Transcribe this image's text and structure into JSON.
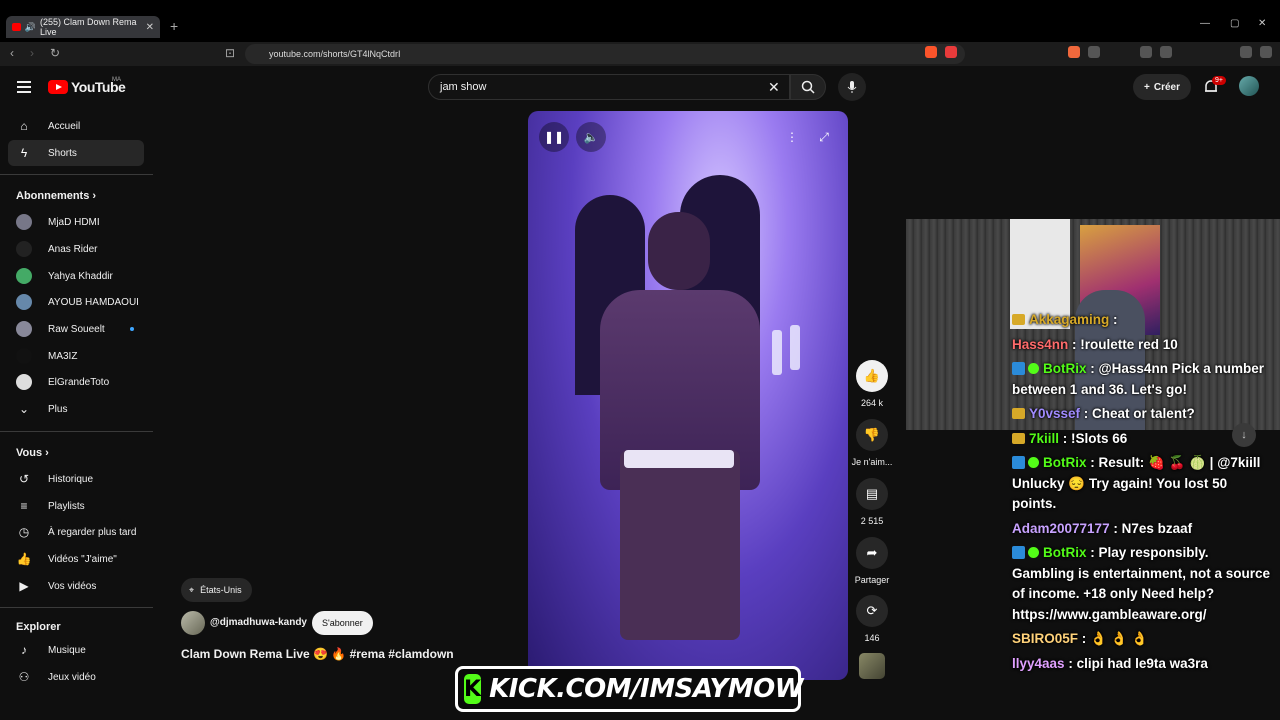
{
  "browser": {
    "tab_title": "(255) Clam Down Rema Live",
    "url": "youtube.com/shorts/GT4lNqCtdrI",
    "new_tab": "+",
    "close_tab": "✕"
  },
  "header": {
    "logo_text": "YouTube",
    "region": "MA",
    "search_value": "jam show",
    "create_label": "Créer",
    "notif_count": "9+"
  },
  "sidebar": {
    "main": [
      {
        "label": "Accueil",
        "icon": "home-icon"
      },
      {
        "label": "Shorts",
        "icon": "shorts-icon"
      }
    ],
    "subs_title": "Abonnements",
    "subs": [
      {
        "label": "MjaD HDMI"
      },
      {
        "label": "Anas Rider"
      },
      {
        "label": "Yahya Khaddir"
      },
      {
        "label": "AYOUB HAMDAOUI"
      },
      {
        "label": "Raw Soueelt"
      },
      {
        "label": "MA3IZ"
      },
      {
        "label": "ElGrandeToto"
      },
      {
        "label": "Plus"
      }
    ],
    "you_title": "Vous",
    "you": [
      {
        "label": "Historique"
      },
      {
        "label": "Playlists"
      },
      {
        "label": "À regarder plus tard"
      },
      {
        "label": "Vidéos \"J'aime\""
      },
      {
        "label": "Vos vidéos"
      }
    ],
    "explore_title": "Explorer",
    "explore": [
      {
        "label": "Musique"
      },
      {
        "label": "Jeux vidéo"
      }
    ]
  },
  "short": {
    "location": "États-Unis",
    "channel": "@djmadhuwa-kandy",
    "subscribe": "S'abonner",
    "title": "Clam Down Rema Live 😍 🔥 #rema #clamdown",
    "likes": "264 k",
    "dislike_label": "Je n'aim...",
    "comments": "2 515",
    "share_label": "Partager",
    "remix": "146"
  },
  "chat": [
    {
      "user": "Akkagaming",
      "msg": "",
      "color": "#d7a928",
      "badge": "mod"
    },
    {
      "user": "Hass4nn",
      "msg": "!roulette red 10",
      "color": "#ff6b6b",
      "badge": ""
    },
    {
      "user": "BotRix",
      "msg": "@Hass4nn Pick a number between 1 and 36. Let's go!",
      "color": "#53fc18",
      "badge": "bot"
    },
    {
      "user": "Y0vssef",
      "msg": "Cheat or talent?",
      "color": "#a08bff",
      "badge": "mod"
    },
    {
      "user": "7kiill",
      "msg": "!Slots 66",
      "color": "#53fc18",
      "badge": "mod"
    },
    {
      "user": "BotRix",
      "msg": "Result: 🍓 🍒 🍈 | @7kiill Unlucky 😔 Try again! You lost 50 points.",
      "color": "#53fc18",
      "badge": "bot"
    },
    {
      "user": "Adam20077177",
      "msg": "N7es bzaaf",
      "color": "#c8a2ff",
      "badge": ""
    },
    {
      "user": "BotRix",
      "msg": "Play responsibly. Gambling is entertainment, not a source of income. +18 only Need help? https://www.gambleaware.org/",
      "color": "#53fc18",
      "badge": "bot"
    },
    {
      "user": "SBIRO05F",
      "msg": "👌 👌 👌",
      "color": "#ffd27a",
      "badge": ""
    },
    {
      "user": "llyy4aas",
      "msg": "clipi had le9ta wa3ra",
      "color": "#e0a0ff",
      "badge": ""
    }
  ],
  "banner": {
    "logo_letter": "K",
    "text": "KICK.COM/IMSAYMOW"
  }
}
